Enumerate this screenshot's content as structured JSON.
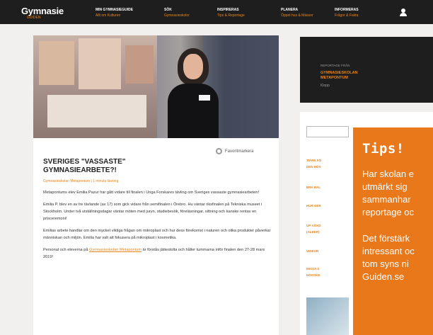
{
  "site": {
    "logo": "Gymnasie",
    "logo_sub": "GUIDEN"
  },
  "nav": [
    {
      "title": "MIN GYMNASIEGUIDE",
      "sub": "Allt om Kulturen"
    },
    {
      "title": "SÖK",
      "sub": "Gymnasieskolor"
    },
    {
      "title": "INSPIRERAS",
      "sub": "Tips & Reportage"
    },
    {
      "title": "PLANERA",
      "sub": "Öppet hus & Mässor"
    },
    {
      "title": "INFORMERAS",
      "sub": "Frågor & Fakta"
    }
  ],
  "article": {
    "favorite_label": "Favoritmarkera",
    "title_line1": "SVERIGES \"VASSASTE\"",
    "title_line2": "GYMNASIEARBETE?!",
    "meta": "Gymnasieskolan Metapontum  |  1 minuts läsning",
    "p1": "Metapontums elev Emilia Pazur har gått vidare till finalen i Unga Forskares tävling om Sveriges vassaste gymnasiearbeten!",
    "p2": "Emilia P. blev en av tre tävlande (av 17) som gick vidare från semifinalen i Örebro. Hu väntar riksfinalen på Tekniska museet i Stockholm. Under två utställningsdagar väntar möten med juryn, studiebesök, föreläsningar, sittning och kanske rentav en prisceremoni!",
    "p3": "Emilias arbete handlar om den mycket viktiga frågan om mikroplast och hur dess förekomst i naturen och olika produkter påverkar människan och miljön. Emilia har valt att fokusera på mikroplast i kosmetika.",
    "p4_before": "Personal och eleverna på ",
    "p4_link": "Gymnasieskolan Metapontum",
    "p4_after": " är förstås jättestolta och håller tummarna inför finalen den 27-28 mars 2019!"
  },
  "reportage": {
    "label": "REPORTAGE FRÅN",
    "school_line1": "GYMNASIESKOLAN",
    "school_line2": "METAPONTUM",
    "more": "Klopp"
  },
  "sidebar_items": [
    "TIÄRA FÖ",
    "DEN HÖS",
    "BRA BAL",
    "HUR GER",
    "UP-VÖXD",
    "(ALBER)",
    "VIDEOR",
    "MISSA II",
    "HÖGSKE"
  ],
  "tips": {
    "title": "Tips!",
    "p1_l1": "Har skolan e",
    "p1_l2": "utmärkt sig",
    "p1_l3": "sammanhar",
    "p1_l4": "reportage oc",
    "p2_l1": "Det förstärk",
    "p2_l2": "intressant oc",
    "p2_l3": "tom syns ni",
    "p2_l4": "Guiden.se"
  }
}
